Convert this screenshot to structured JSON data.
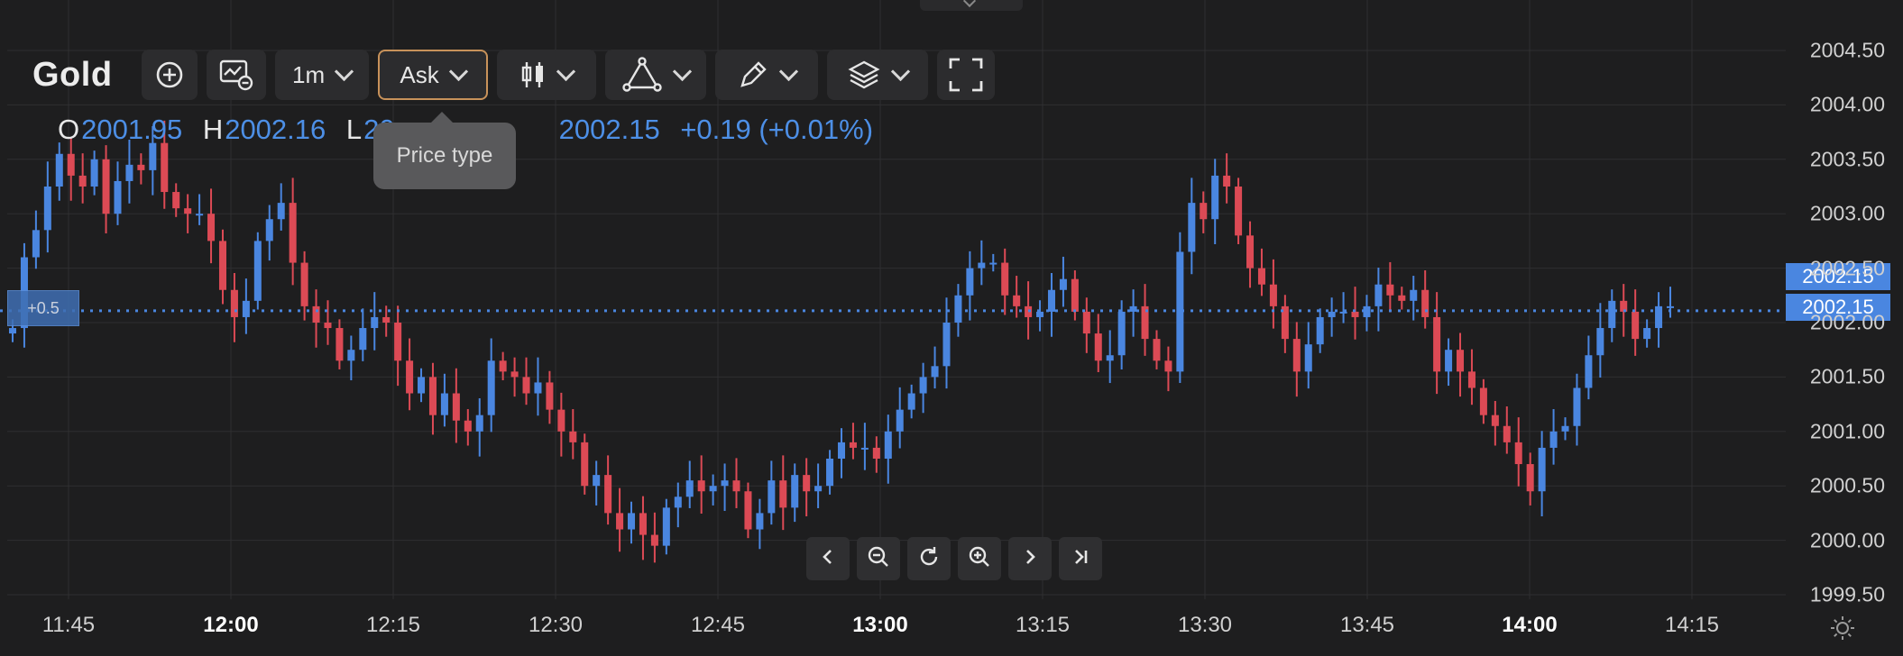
{
  "header": {
    "instrument": "Gold",
    "interval": "1m",
    "price_type": "Ask",
    "tooltip": "Price type"
  },
  "toolbar": {
    "add_icon": "plus-circle-icon",
    "indicators_icon": "indicators-icon",
    "chart_type_icon": "candles-icon",
    "drawing_tools_icon": "triangle-icon",
    "brush_icon": "pencil-icon",
    "layers_icon": "layers-icon",
    "fullscreen_icon": "fullscreen-icon"
  },
  "ohlc": {
    "o_label": "O",
    "o_value": "2001.95",
    "h_label": "H",
    "h_value": "2002.16",
    "l_label": "L",
    "l_value": "20",
    "c_value": "2002.15",
    "change": "+0.19 (+0.01%)"
  },
  "current_price_labels": [
    "2002.15",
    "2002.15"
  ],
  "crosshair_tag": "+0.5",
  "colors": {
    "up": "#4a86e0",
    "down": "#dc4a55",
    "background": "#1e1e1f",
    "accent": "#c8925a"
  },
  "nav_icons": [
    "chevron-left-icon",
    "zoom-out-icon",
    "reset-icon",
    "zoom-in-icon",
    "chevron-right-icon",
    "go-to-end-icon"
  ],
  "chart_data": {
    "type": "candlestick",
    "instrument": "Gold",
    "interval": "1m",
    "ylim": [
      1999.5,
      2004.5
    ],
    "y_ticks": [
      "2004.50",
      "2004.00",
      "2003.50",
      "2003.00",
      "2002.50",
      "2002.00",
      "2001.50",
      "2001.00",
      "2000.50",
      "2000.00",
      "1999.50"
    ],
    "x_ticks": [
      {
        "label": "11:45",
        "bold": false
      },
      {
        "label": "12:00",
        "bold": true
      },
      {
        "label": "12:15",
        "bold": false
      },
      {
        "label": "12:30",
        "bold": false
      },
      {
        "label": "12:45",
        "bold": false
      },
      {
        "label": "13:00",
        "bold": true
      },
      {
        "label": "13:15",
        "bold": false
      },
      {
        "label": "13:30",
        "bold": false
      },
      {
        "label": "13:45",
        "bold": false
      },
      {
        "label": "14:00",
        "bold": true
      },
      {
        "label": "14:15",
        "bold": false
      }
    ],
    "current_price": 2002.15,
    "grid": true,
    "close_series": [
      2001.95,
      2002.6,
      2002.85,
      2003.25,
      2003.55,
      2003.35,
      2003.25,
      2003.5,
      2003.0,
      2003.3,
      2003.45,
      2003.4,
      2003.65,
      2003.2,
      2003.05,
      2003.0,
      2003.0,
      2002.75,
      2002.3,
      2002.05,
      2002.2,
      2002.75,
      2002.95,
      2003.1,
      2002.55,
      2002.15,
      2002.0,
      2001.95,
      2001.65,
      2001.75,
      2001.95,
      2002.05,
      2002.0,
      2001.65,
      2001.35,
      2001.5,
      2001.15,
      2001.35,
      2001.1,
      2001.0,
      2001.15,
      2001.65,
      2001.55,
      2001.5,
      2001.35,
      2001.45,
      2001.2,
      2001.0,
      2000.9,
      2000.5,
      2000.6,
      2000.25,
      2000.1,
      2000.25,
      2000.05,
      1999.95,
      2000.3,
      2000.4,
      2000.55,
      2000.45,
      2000.5,
      2000.55,
      2000.45,
      2000.1,
      2000.25,
      2000.55,
      2000.3,
      2000.6,
      2000.45,
      2000.5,
      2000.75,
      2000.9,
      2000.85,
      2000.85,
      2000.75,
      2001.0,
      2001.2,
      2001.35,
      2001.5,
      2001.6,
      2002.0,
      2002.25,
      2002.5,
      2002.55,
      2002.55,
      2002.25,
      2002.15,
      2002.05,
      2002.1,
      2002.3,
      2002.4,
      2002.1,
      2001.9,
      2001.65,
      2001.7,
      2002.1,
      2002.15,
      2001.85,
      2001.65,
      2001.55,
      2002.65,
      2003.1,
      2002.95,
      2003.35,
      2003.25,
      2002.8,
      2002.5,
      2002.35,
      2002.15,
      2001.85,
      2001.55,
      2001.8,
      2002.05,
      2002.1,
      2002.1,
      2002.05,
      2002.15,
      2002.35,
      2002.25,
      2002.2,
      2002.3,
      2002.05,
      2001.55,
      2001.75,
      2001.55,
      2001.4,
      2001.15,
      2001.05,
      2000.9,
      2000.7,
      2000.45,
      2000.85,
      2001.0,
      2001.05,
      2001.4,
      2001.7,
      2001.95,
      2002.2,
      2002.1,
      2001.85,
      2001.95,
      2002.15,
      2002.15
    ]
  }
}
